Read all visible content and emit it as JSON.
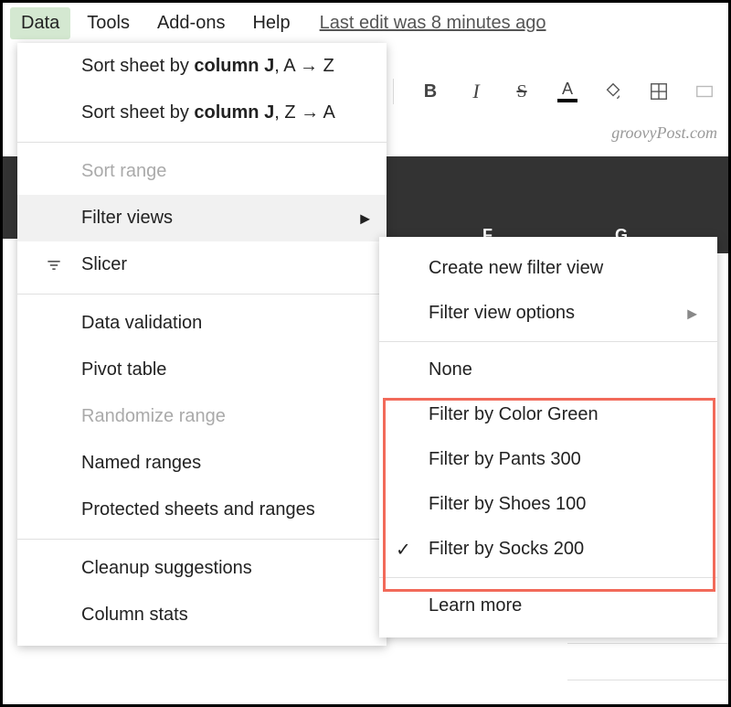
{
  "menubar": {
    "data": "Data",
    "tools": "Tools",
    "addons": "Add-ons",
    "help": "Help",
    "last_edit": "Last edit was 8 minutes ago"
  },
  "toolbar": {
    "bold": "B",
    "italic": "I",
    "strike": "S",
    "textcolor": "A"
  },
  "watermark": "groovyPost.com",
  "colheaders": {
    "F": "F",
    "G": "G"
  },
  "dropdown": {
    "sort_az_pre": "Sort sheet by ",
    "sort_az_col": "column J",
    "sort_az_suf": ", A → Z",
    "sort_za_pre": "Sort sheet by ",
    "sort_za_col": "column J",
    "sort_za_suf": ", Z → A",
    "sort_range": "Sort range",
    "filter_views": "Filter views",
    "slicer": "Slicer",
    "data_validation": "Data validation",
    "pivot_table": "Pivot table",
    "randomize": "Randomize range",
    "named_ranges": "Named ranges",
    "protected": "Protected sheets and ranges",
    "cleanup": "Cleanup suggestions",
    "column_stats": "Column stats"
  },
  "submenu": {
    "create": "Create new filter view",
    "options": "Filter view options",
    "none": "None",
    "filters": [
      "Filter by Color Green",
      "Filter by Pants 300",
      "Filter by Shoes 100",
      "Filter by Socks 200"
    ],
    "checked_index": 3,
    "learn_more": "Learn more"
  }
}
